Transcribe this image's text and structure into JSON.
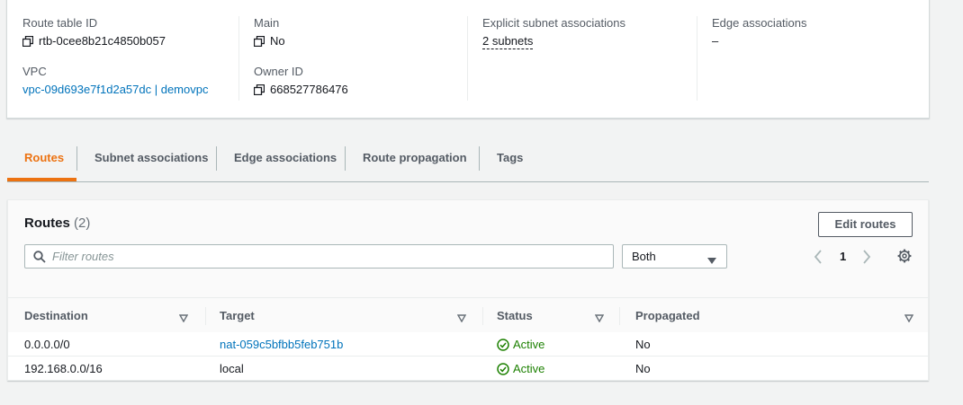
{
  "details": {
    "route_table_id_label": "Route table ID",
    "route_table_id": "rtb-0cee8b21c4850b057",
    "vpc_label": "VPC",
    "vpc_value": "vpc-09d693e7f1d2a57dc | demovpc",
    "main_label": "Main",
    "main_value": "No",
    "owner_id_label": "Owner ID",
    "owner_id": "668527786476",
    "explicit_subnet_label": "Explicit subnet associations",
    "explicit_subnet_value": "2 subnets",
    "edge_assoc_label": "Edge associations",
    "edge_assoc_value": "–"
  },
  "tabs": [
    {
      "label": "Routes",
      "active": true
    },
    {
      "label": "Subnet associations",
      "active": false
    },
    {
      "label": "Edge associations",
      "active": false
    },
    {
      "label": "Route propagation",
      "active": false
    },
    {
      "label": "Tags",
      "active": false
    }
  ],
  "routes": {
    "title": "Routes",
    "count": "(2)",
    "edit_button": "Edit routes",
    "filter_placeholder": "Filter routes",
    "filter_value": "",
    "select_value": "Both",
    "page_number": "1",
    "columns": [
      "Destination",
      "Target",
      "Status",
      "Propagated"
    ],
    "rows": [
      {
        "destination": "0.0.0.0/0",
        "target": "nat-059c5bfbb5feb751b",
        "target_is_link": true,
        "status": "Active",
        "propagated": "No"
      },
      {
        "destination": "192.168.0.0/16",
        "target": "local",
        "target_is_link": false,
        "status": "Active",
        "propagated": "No"
      }
    ]
  },
  "colors": {
    "accent": "#ec7211",
    "link": "#0073bb",
    "success": "#1d8102"
  }
}
